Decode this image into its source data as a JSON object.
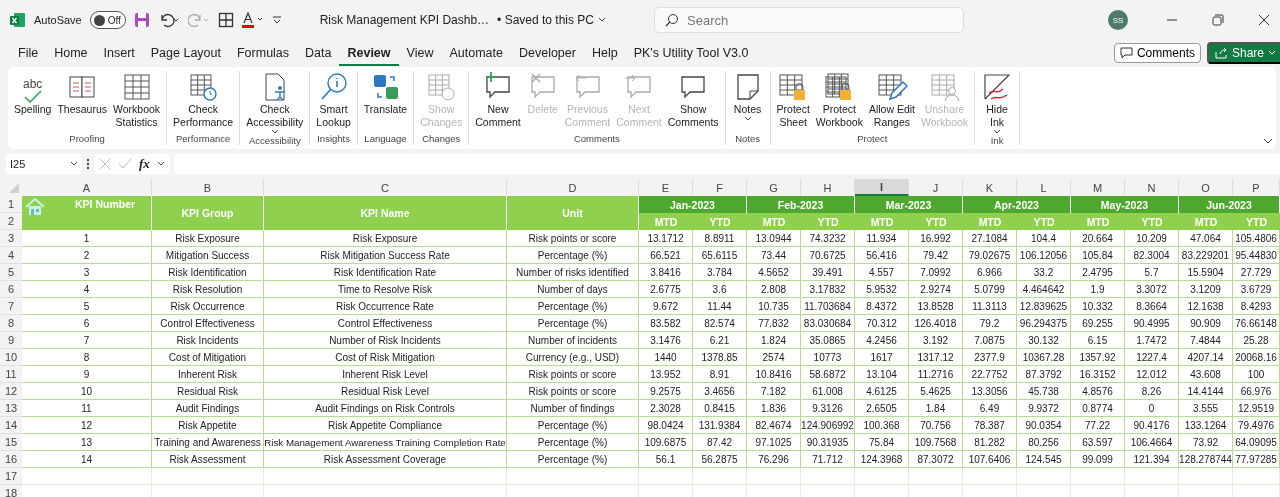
{
  "title_bar": {
    "autosave_label": "AutoSave",
    "autosave": {
      "label": "Off",
      "on": false
    },
    "document_title": "Risk Management KPI Dashb…",
    "save_status": "• Saved to this PC",
    "search": {
      "placeholder": "Search"
    },
    "avatar": "SS"
  },
  "menu_tabs": [
    {
      "label": "File",
      "selected": false
    },
    {
      "label": "Home",
      "selected": false
    },
    {
      "label": "Insert",
      "selected": false
    },
    {
      "label": "Page Layout",
      "selected": false
    },
    {
      "label": "Formulas",
      "selected": false
    },
    {
      "label": "Data",
      "selected": false
    },
    {
      "label": "Review",
      "selected": true
    },
    {
      "label": "View",
      "selected": false
    },
    {
      "label": "Automate",
      "selected": false
    },
    {
      "label": "Developer",
      "selected": false
    },
    {
      "label": "Help",
      "selected": false
    },
    {
      "label": "PK's Utility Tool V3.0",
      "selected": false
    }
  ],
  "comments_button": "Comments",
  "share_button": "Share",
  "ribbon_groups": [
    {
      "label": "Proofing",
      "buttons": [
        {
          "label": "Spelling",
          "icon_text": "abc",
          "disabled": false
        },
        {
          "label": "Thesaurus",
          "disabled": false
        },
        {
          "label": "Workbook\nStatistics",
          "disabled": false
        }
      ]
    },
    {
      "label": "Performance",
      "buttons": [
        {
          "label": "Check\nPerformance",
          "disabled": false
        }
      ]
    },
    {
      "label": "Accessibility",
      "buttons": [
        {
          "label": "Check\nAccessibility",
          "disabled": false,
          "dropdown": true
        }
      ]
    },
    {
      "label": "Insights",
      "buttons": [
        {
          "label": "Smart\nLookup",
          "disabled": false
        }
      ]
    },
    {
      "label": "Language",
      "buttons": [
        {
          "label": "Translate",
          "disabled": false
        }
      ]
    },
    {
      "label": "Changes",
      "buttons": [
        {
          "label": "Show\nChanges",
          "disabled": true
        }
      ]
    },
    {
      "label": "Comments",
      "buttons": [
        {
          "label": "New\nComment",
          "disabled": false
        },
        {
          "label": "Delete",
          "disabled": true
        },
        {
          "label": "Previous\nComment",
          "disabled": true
        },
        {
          "label": "Next\nComment",
          "disabled": true
        },
        {
          "label": "Show\nComments",
          "disabled": false
        }
      ]
    },
    {
      "label": "Notes",
      "buttons": [
        {
          "label": "Notes",
          "disabled": false,
          "dropdown": true
        }
      ]
    },
    {
      "label": "Protect",
      "buttons": [
        {
          "label": "Protect\nSheet",
          "disabled": false
        },
        {
          "label": "Protect\nWorkbook",
          "disabled": false
        },
        {
          "label": "Allow Edit\nRanges",
          "disabled": false
        },
        {
          "label": "Unshare\nWorkbook",
          "disabled": true
        }
      ]
    },
    {
      "label": "Ink",
      "buttons": [
        {
          "label": "Hide\nInk",
          "disabled": false,
          "dropdown": true
        }
      ]
    }
  ],
  "formula_bar": {
    "name_box": "I25",
    "function_label": "fx"
  },
  "columns": [
    {
      "letter": "A",
      "selected": false
    },
    {
      "letter": "B",
      "selected": false
    },
    {
      "letter": "C",
      "selected": false
    },
    {
      "letter": "D",
      "selected": false
    },
    {
      "letter": "E",
      "selected": false
    },
    {
      "letter": "F",
      "selected": false
    },
    {
      "letter": "G",
      "selected": false
    },
    {
      "letter": "H",
      "selected": false
    },
    {
      "letter": "I",
      "selected": true
    },
    {
      "letter": "J",
      "selected": false
    },
    {
      "letter": "K",
      "selected": false
    },
    {
      "letter": "L",
      "selected": false
    },
    {
      "letter": "M",
      "selected": false
    },
    {
      "letter": "N",
      "selected": false
    },
    {
      "letter": "O",
      "selected": false
    },
    {
      "letter": "P",
      "selected": false
    }
  ],
  "row_numbers": [
    "1",
    "2",
    "3",
    "4",
    "5",
    "6",
    "7",
    "8",
    "9",
    "10",
    "11",
    "12",
    "13",
    "14",
    "15",
    "16",
    "17",
    "18"
  ],
  "headers": [
    "KPI Number",
    "KPI Group",
    "KPI Name",
    "Unit"
  ],
  "months": [
    {
      "label": "Jan-2023",
      "mtd": "MTD",
      "ytd": "YTD"
    },
    {
      "label": "Feb-2023",
      "mtd": "MTD",
      "ytd": "YTD"
    },
    {
      "label": "Mar-2023",
      "mtd": "MTD",
      "ytd": "YTD"
    },
    {
      "label": "Apr-2023",
      "mtd": "MTD",
      "ytd": "YTD"
    },
    {
      "label": "May-2023",
      "mtd": "MTD",
      "ytd": "YTD"
    },
    {
      "label": "Jun-2023",
      "mtd": "MTD",
      "ytd": "YTD"
    }
  ],
  "kpis": [
    {
      "number": "1",
      "group": "Risk Exposure",
      "name": "Risk Exposure",
      "unit": "Risk points or score",
      "values": [
        "13.1712",
        "8.8911",
        "13.0944",
        "74.3232",
        "11.934",
        "16.992",
        "27.1084",
        "104.4",
        "20.664",
        "10.209",
        "47.064",
        "105.4806"
      ]
    },
    {
      "number": "2",
      "group": "Mitigation Success",
      "name": "Risk Mitigation Success Rate",
      "unit": "Percentage (%)",
      "values": [
        "66.521",
        "65.6115",
        "73.44",
        "70.6725",
        "56.416",
        "79.42",
        "79.02675",
        "106.12056",
        "105.84",
        "82.3004",
        "83.229201",
        "95.44830"
      ]
    },
    {
      "number": "3",
      "group": "Risk Identification",
      "name": "Risk Identification Rate",
      "unit": "Number of risks identified",
      "values": [
        "3.8416",
        "3.784",
        "4.5652",
        "39.491",
        "4.557",
        "7.0992",
        "6.966",
        "33.2",
        "2.4795",
        "5.7",
        "15.5904",
        "27.729"
      ]
    },
    {
      "number": "4",
      "group": "Risk Resolution",
      "name": "Time to Resolve Risk",
      "unit": "Number of days",
      "values": [
        "2.6775",
        "3.6",
        "2.808",
        "3.17832",
        "5.9532",
        "2.9274",
        "5.0799",
        "4.464642",
        "1.9",
        "3.3072",
        "3.1209",
        "3.6729"
      ]
    },
    {
      "number": "5",
      "group": "Risk Occurrence",
      "name": "Risk Occurrence Rate",
      "unit": "Percentage (%)",
      "values": [
        "9.672",
        "11.44",
        "10.735",
        "11.703684",
        "8.4372",
        "13.8528",
        "11.3113",
        "12.839625",
        "10.332",
        "8.3664",
        "12.1638",
        "8.4293"
      ]
    },
    {
      "number": "6",
      "group": "Control Effectiveness",
      "name": "Control Effectiveness",
      "unit": "Percentage (%)",
      "values": [
        "83.582",
        "82.574",
        "77.832",
        "83.030684",
        "70.312",
        "126.4018",
        "79.2",
        "96.294375",
        "69.255",
        "90.4995",
        "90.909",
        "76.66148"
      ]
    },
    {
      "number": "7",
      "group": "Risk Incidents",
      "name": "Number of Risk Incidents",
      "unit": "Number of incidents",
      "values": [
        "3.1476",
        "6.21",
        "1.824",
        "35.0865",
        "4.2456",
        "3.192",
        "7.0875",
        "30.132",
        "6.15",
        "1.7472",
        "7.4844",
        "25.28"
      ]
    },
    {
      "number": "8",
      "group": "Cost of Mitigation",
      "name": "Cost of Risk Mitigation",
      "unit": "Currency (e.g., USD)",
      "values": [
        "1440",
        "1378.85",
        "2574",
        "10773",
        "1617",
        "1317.12",
        "2377.9",
        "10367.28",
        "1357.92",
        "1227.4",
        "4207.14",
        "20068.16"
      ]
    },
    {
      "number": "9",
      "group": "Inherent Risk",
      "name": "Inherent Risk Level",
      "unit": "Risk points or score",
      "values": [
        "13.952",
        "8.91",
        "10.8416",
        "58.6872",
        "13.104",
        "11.2716",
        "22.7752",
        "87.3792",
        "16.3152",
        "12.012",
        "43.608",
        "100"
      ]
    },
    {
      "number": "10",
      "group": "Residual Risk",
      "name": "Residual Risk Level",
      "unit": "Risk points or score",
      "values": [
        "9.2575",
        "3.4656",
        "7.182",
        "61.008",
        "4.6125",
        "5.4625",
        "13.3056",
        "45.738",
        "4.8576",
        "8.26",
        "14.4144",
        "66.976"
      ]
    },
    {
      "number": "11",
      "group": "Audit Findings",
      "name": "Audit Findings on Risk Controls",
      "unit": "Number of findings",
      "values": [
        "2.3028",
        "0.8415",
        "1.836",
        "9.3126",
        "2.6505",
        "1.84",
        "6.49",
        "9.9372",
        "0.8774",
        "0",
        "3.555",
        "12.9519"
      ]
    },
    {
      "number": "12",
      "group": "Risk Appetite",
      "name": "Risk Appetite Compliance",
      "unit": "Percentage (%)",
      "values": [
        "98.0424",
        "131.9384",
        "82.4674",
        "124.906992",
        "100.368",
        "70.756",
        "78.387",
        "90.0354",
        "77.22",
        "90.4176",
        "133.1264",
        "79.4976"
      ]
    },
    {
      "number": "13",
      "group": "Training and Awareness",
      "name": "Risk Management Awareness Training Completion Rate",
      "unit": "Percentage (%)",
      "values": [
        "109.6875",
        "87.42",
        "97.1025",
        "90.31935",
        "75.84",
        "109.7568",
        "81.282",
        "80.256",
        "63.597",
        "106.4664",
        "73.92",
        "64.09095"
      ]
    },
    {
      "number": "14",
      "group": "Risk Assessment",
      "name": "Risk Assessment Coverage",
      "unit": "Percentage (%)",
      "values": [
        "56.1",
        "56.2875",
        "76.296",
        "71.712",
        "124.3968",
        "87.3072",
        "107.6406",
        "124.545",
        "99.099",
        "121.394",
        "128.278744",
        "77.97285"
      ]
    }
  ]
}
